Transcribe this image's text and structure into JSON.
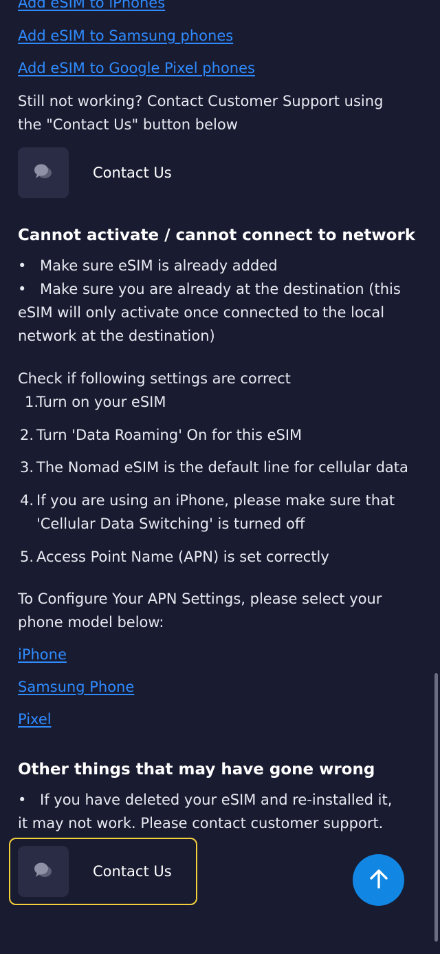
{
  "links_top": {
    "iphones": "Add eSIM to iPhones",
    "samsung": "Add eSIM to Samsung phones",
    "pixel": "Add eSIM to Google Pixel phones"
  },
  "still_not_working": "Still not working? Contact Customer Support using the \"Contact Us\" button below",
  "contact_button_label": "Contact Us",
  "section_activate": {
    "title": "Cannot activate / cannot connect to network",
    "bullets": [
      "Make sure eSIM is already added",
      "Make sure you are already at the destination (this eSIM will only activate once connected to the local network at the destination)"
    ],
    "settings_intro": "Check if following settings are correct",
    "steps": [
      {
        "num": "1.",
        "text": "Turn on your eSIM"
      },
      {
        "num": "2.",
        "text": "Turn 'Data Roaming' On for this eSIM"
      },
      {
        "num": "3.",
        "text": "The Nomad eSIM is the default line for cellular data"
      },
      {
        "num": "4.",
        "text": "If you are using an iPhone, please make sure that 'Cellular Data Switching' is turned off"
      },
      {
        "num": "5.",
        "text": "Access Point Name (APN) is set correctly"
      }
    ],
    "apn_intro": "To Configure Your APN Settings, please select your phone model below:",
    "apn_links": [
      "iPhone",
      "Samsung Phone",
      "Pixel"
    ]
  },
  "section_other": {
    "title": "Other things that may have gone wrong",
    "bullets": [
      "If you have deleted your eSIM and re-installed it, it may not work. Please contact customer support."
    ]
  },
  "icons": {
    "chat": "chat-bubbles-icon",
    "scroll_top": "arrow-up-icon"
  },
  "colors": {
    "background": "#191b30",
    "link": "#2f8bff",
    "focus": "#f3cf3c",
    "fab": "#1187e3"
  }
}
